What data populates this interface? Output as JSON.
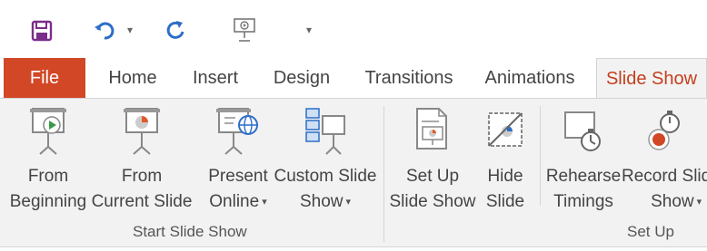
{
  "quick_access": {
    "save_icon": "save-icon",
    "undo_icon": "undo-icon",
    "undo_dropdown": "▾",
    "redo_icon": "repeat-icon",
    "present_icon": "start-from-beginning-icon",
    "customize": "▾"
  },
  "tabs": [
    {
      "label": "File"
    },
    {
      "label": "Home"
    },
    {
      "label": "Insert"
    },
    {
      "label": "Design"
    },
    {
      "label": "Transitions"
    },
    {
      "label": "Animations"
    },
    {
      "label": "Slide Show"
    }
  ],
  "ribbon": {
    "start_group": {
      "label": "Start Slide Show",
      "from_beginning": {
        "line1": "From",
        "line2": "Beginning"
      },
      "from_current": {
        "line1": "From",
        "line2": "Current Slide"
      },
      "present_online": {
        "line1": "Present",
        "line2": "Online",
        "caret": "▾"
      },
      "custom_show": {
        "line1": "Custom Slide",
        "line2": "Show",
        "caret": "▾"
      }
    },
    "setup_group": {
      "label": "Set Up",
      "setup_show": {
        "line1": "Set Up",
        "line2": "Slide Show"
      },
      "hide_slide": {
        "line1": "Hide",
        "line2": "Slide"
      },
      "rehearse": {
        "line1": "Rehearse",
        "line2": "Timings"
      },
      "record": {
        "line1": "Record Slid",
        "line2": "Show",
        "caret": "▾"
      }
    }
  },
  "colors": {
    "file_tab": "#d24726",
    "active_tab_text": "#c43e1c",
    "save": "#7b2d8b",
    "undo": "#2d6ec7",
    "play": "#3a9a4a",
    "chart_orange": "#e05a2a",
    "record": "#d24726"
  }
}
